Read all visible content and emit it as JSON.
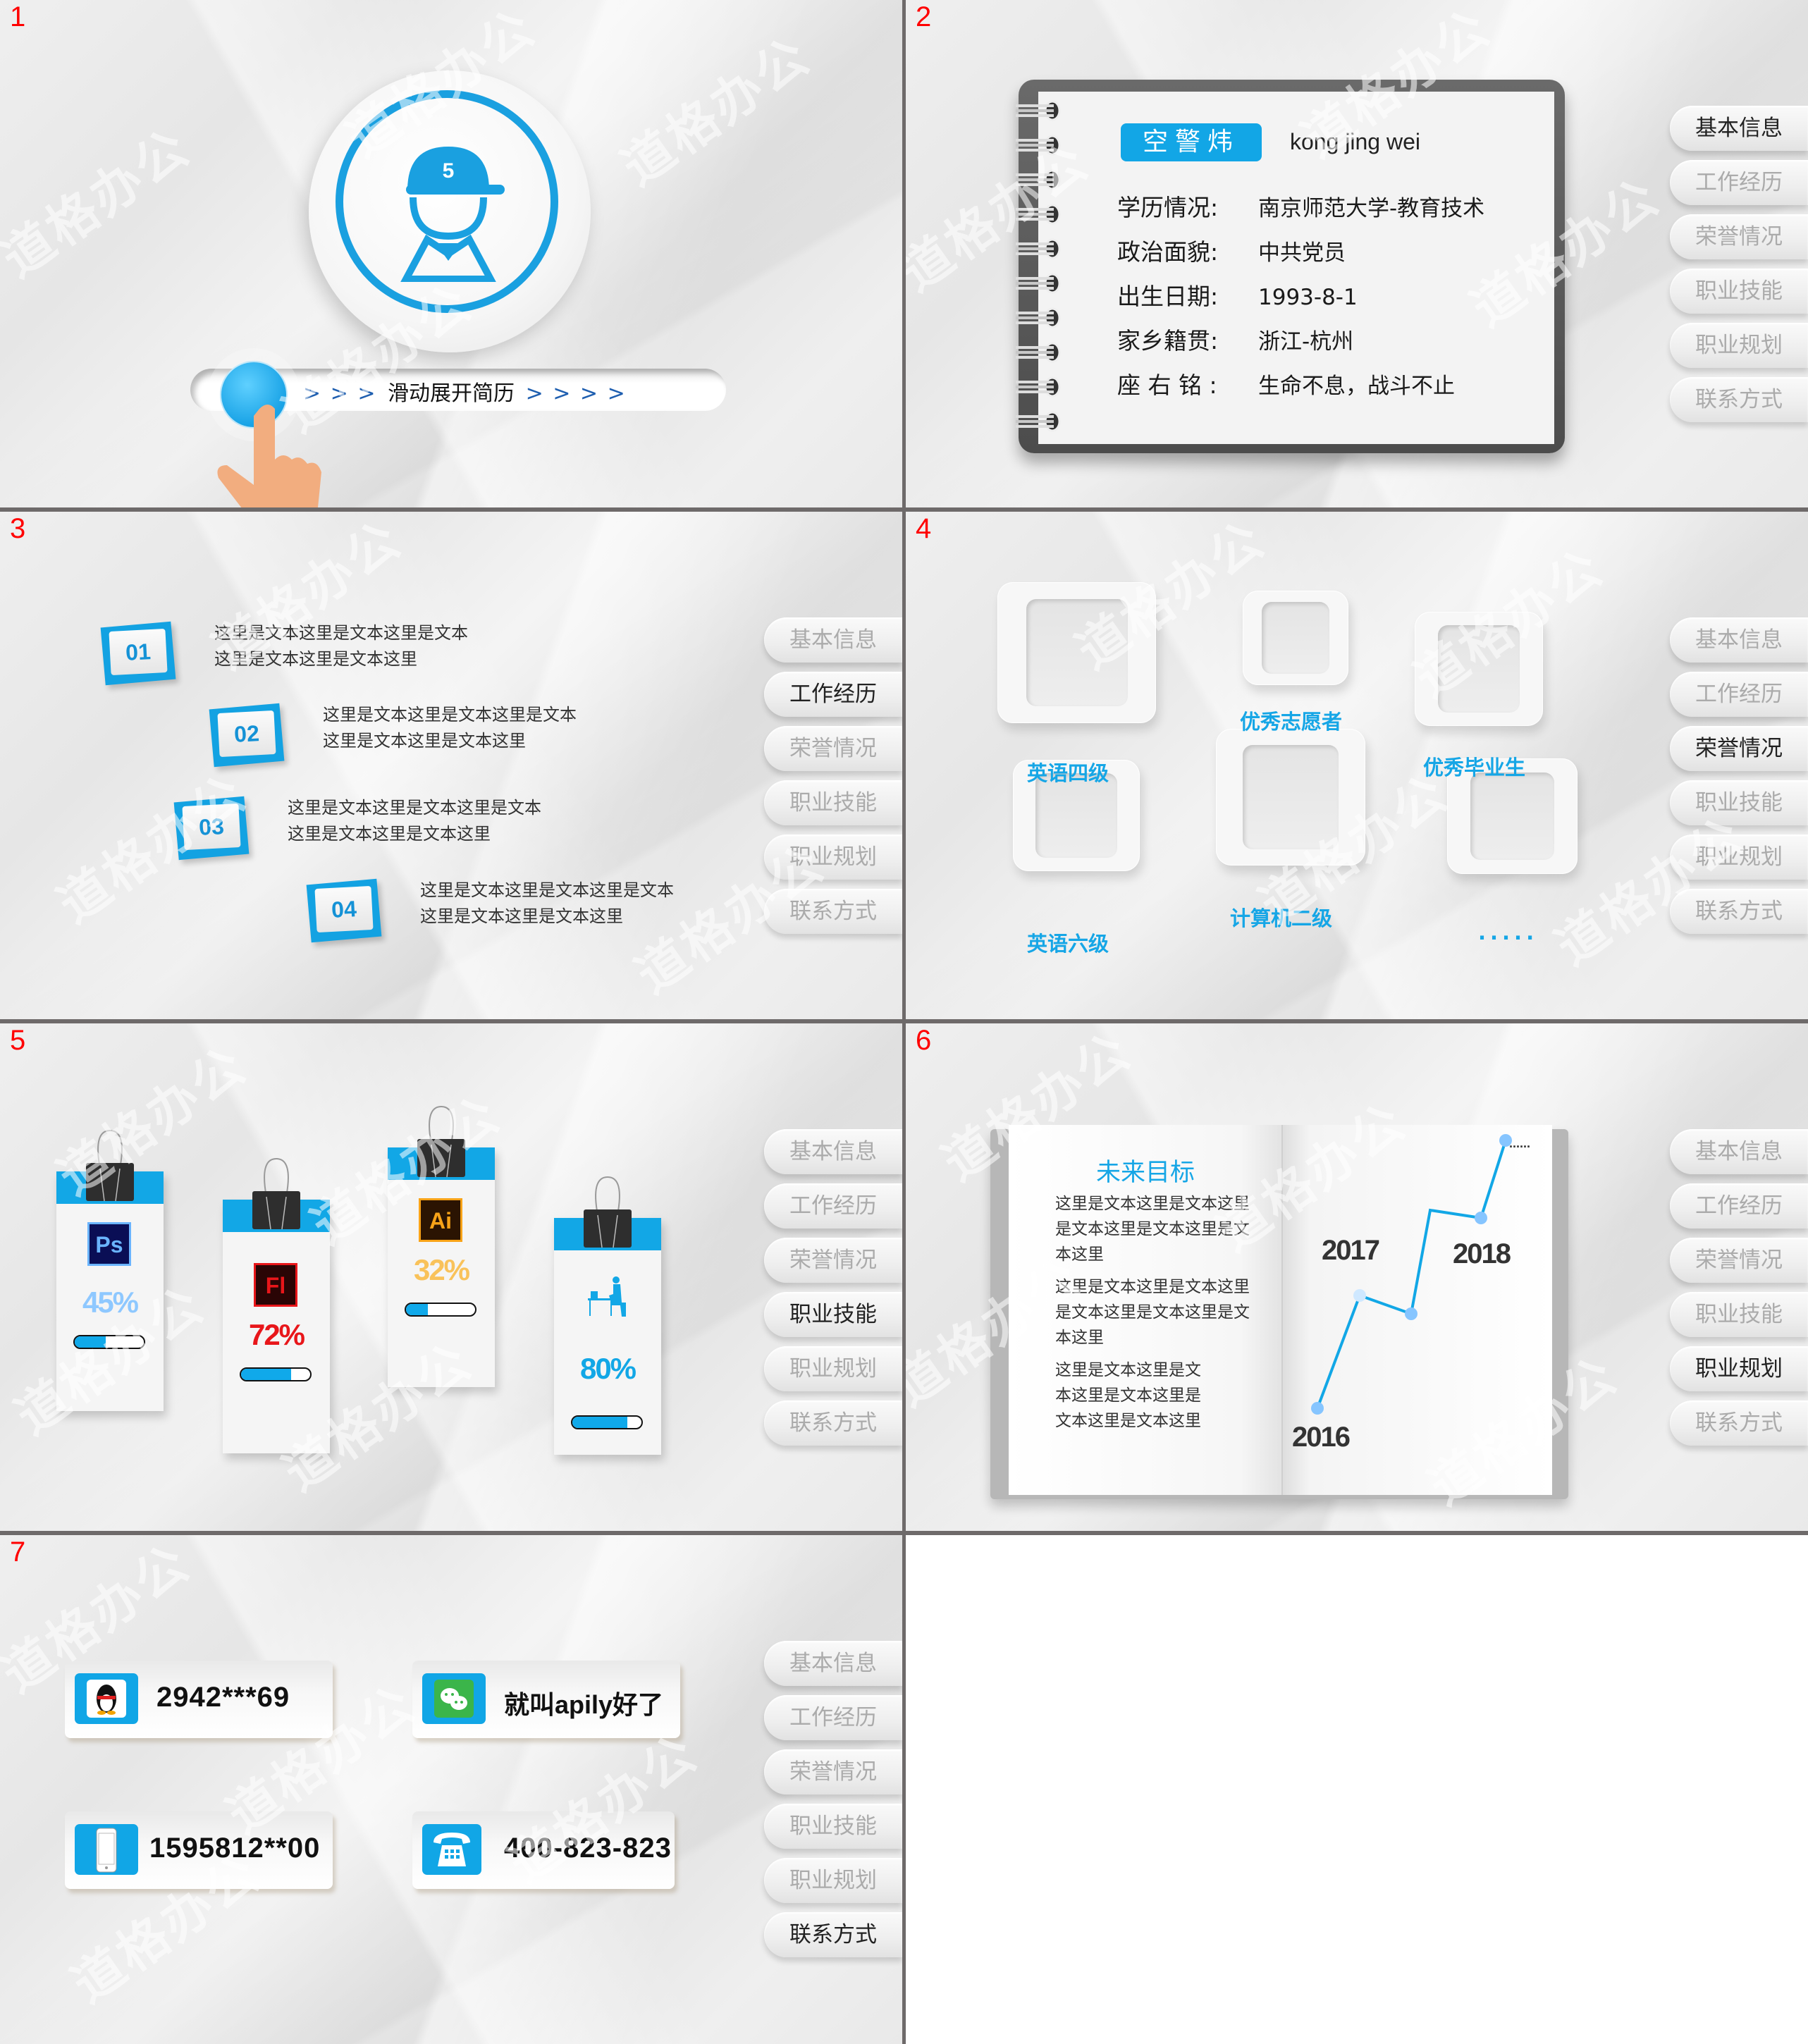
{
  "slide_numbers": [
    "1",
    "2",
    "3",
    "4",
    "5",
    "6",
    "7"
  ],
  "watermark": "道格办公",
  "nav": {
    "items": [
      {
        "label": "基本信息"
      },
      {
        "label": "工作经历"
      },
      {
        "label": "荣誉情况"
      },
      {
        "label": "职业技能"
      },
      {
        "label": "职业规划"
      },
      {
        "label": "联系方式"
      }
    ]
  },
  "slide1": {
    "avatar_badge": "5",
    "slider_arrows_left": "> > >",
    "slider_label": "滑动展开简历",
    "slider_arrows_right": "> > > >"
  },
  "slide2": {
    "active_nav": "基本信息",
    "name": "空警炜",
    "pinyin": "kong jing wei",
    "rows": [
      {
        "key": "学历情况:",
        "value": "南京师范大学-教育技术"
      },
      {
        "key": "政治面貌:",
        "value": "中共党员"
      },
      {
        "key": "出生日期:",
        "value": "1993-8-1"
      },
      {
        "key": "家乡籍贯:",
        "value": "浙江-杭州"
      },
      {
        "key": "座 右 铭 :",
        "value": "生命不息，战斗不止"
      }
    ]
  },
  "slide3": {
    "active_nav": "工作经历",
    "steps": [
      {
        "num": "01",
        "line1": "这里是文本这里是文本这里是文本",
        "line2": "这里是文本这里是文本这里"
      },
      {
        "num": "02",
        "line1": "这里是文本这里是文本这里是文本",
        "line2": "这里是文本这里是文本这里"
      },
      {
        "num": "03",
        "line1": "这里是文本这里是文本这里是文本",
        "line2": "这里是文本这里是文本这里"
      },
      {
        "num": "04",
        "line1": "这里是文本这里是文本这里是文本",
        "line2": "这里是文本这里是文本这里"
      }
    ]
  },
  "slide4": {
    "active_nav": "荣誉情况",
    "honors": [
      "英语四级",
      "优秀志愿者",
      "优秀毕业生",
      "英语六级",
      "计算机二级",
      "....."
    ]
  },
  "slide5": {
    "active_nav": "职业技能",
    "skills": [
      {
        "icon": "Ps",
        "name": "photoshop",
        "percent_label": "45%",
        "progress": 0.45,
        "color": "#8ec8ff",
        "icon_bg": "#0a0e55",
        "icon_fg": "#6ab4ff"
      },
      {
        "icon": "Fl",
        "name": "flash",
        "percent_label": "72%",
        "progress": 0.72,
        "color": "#e8161a",
        "icon_bg": "#2a0505",
        "icon_fg": "#e8161a"
      },
      {
        "icon": "Ai",
        "name": "illustrator",
        "percent_label": "32%",
        "progress": 0.32,
        "color": "#f9c25a",
        "icon_bg": "#2b1402",
        "icon_fg": "#f8a318"
      },
      {
        "icon": "office",
        "name": "office-work",
        "percent_label": "80%",
        "progress": 0.8,
        "color": "#12a7e6",
        "icon_bg": "",
        "icon_fg": "#12a7e6"
      }
    ]
  },
  "slide6": {
    "active_nav": "职业规划",
    "title": "未来目标",
    "paragraphs": [
      "这里是文本这里是文本这里是文本这里是文本这里是文本这里",
      "这里是文本这里是文本这里是文本这里是文本这里是文本这里",
      "这里是文本这里是文本这里是文本这里是文本这里是文本这里"
    ],
    "years": [
      "2016",
      "2017",
      "2018"
    ],
    "ellipsis": "......"
  },
  "slide7": {
    "active_nav": "联系方式",
    "contacts": [
      {
        "type": "qq",
        "value": "2942***69"
      },
      {
        "type": "wechat",
        "value": "就叫apily好了"
      },
      {
        "type": "mobile",
        "value": "1595812**00"
      },
      {
        "type": "telephone",
        "value": "400-823-823"
      }
    ]
  }
}
